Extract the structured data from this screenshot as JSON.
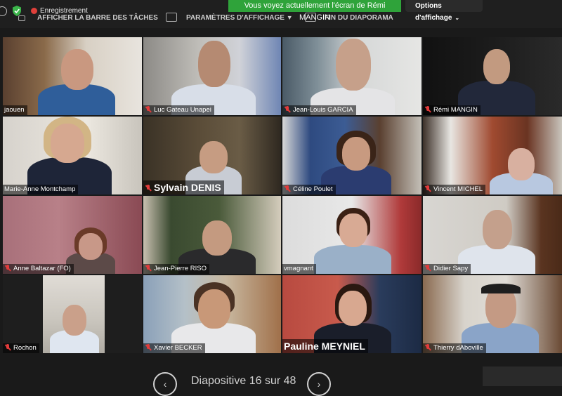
{
  "toolbar": {
    "recording_label": "Enregistrement",
    "show_taskbar_label": "AFFICHER LA BARRE DES TÂCHES",
    "display_settings_label": "PARAMÈTRES D'AFFICHAGE",
    "display_settings_chevron": "▼",
    "end_slideshow_label": "FIN DU DIAPORAMA",
    "share_banner": "Vous voyez actuellement l'écran de Rémi MANGIN",
    "view_options_label": "Options d'affichage",
    "view_options_chevron": "⌄"
  },
  "participants": [
    {
      "name": "jaouen",
      "muted": false
    },
    {
      "name": "Luc Gateau Unapei",
      "muted": true
    },
    {
      "name": "Jean-Louis GARCIA",
      "muted": true
    },
    {
      "name": "Rémi MANGIN",
      "muted": true
    },
    {
      "name": "Marie-Anne Montchamp",
      "muted": false
    },
    {
      "name": "Sylvain DENIS",
      "muted": true
    },
    {
      "name": "Céline Poulet",
      "muted": true
    },
    {
      "name": "Vincent MICHEL",
      "muted": true
    },
    {
      "name": "Anne Baltazar (FO)",
      "muted": true
    },
    {
      "name": "Jean-Pierre RISO",
      "muted": true
    },
    {
      "name": "vmagnant",
      "muted": false
    },
    {
      "name": "Didier Sapy",
      "muted": true
    },
    {
      "name": "Rochon",
      "muted": true
    },
    {
      "name": "Xavier BECKER",
      "muted": true
    },
    {
      "name": "Pauline MEYNIEL",
      "muted": false
    },
    {
      "name": "Thierry dAboville",
      "muted": true
    }
  ],
  "slideshow": {
    "slide_label": "Diapositive 16 sur 48",
    "prev_icon": "‹",
    "next_icon": "›"
  },
  "colors": {
    "banner_green": "#2fa33a",
    "active_outline": "#7ed35a",
    "muted_red": "#e23b3b"
  }
}
